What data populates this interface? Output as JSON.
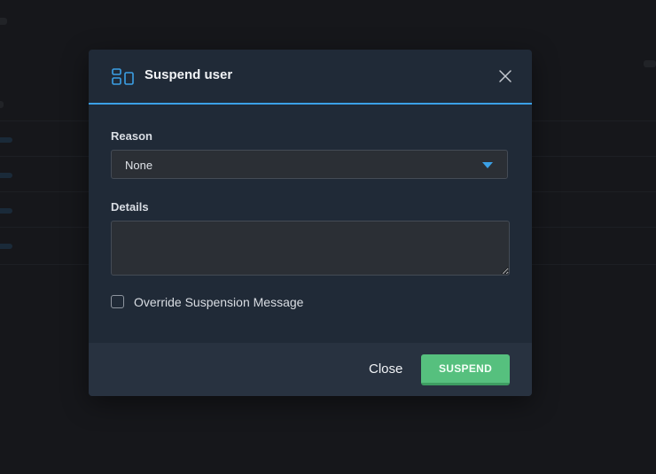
{
  "modal": {
    "title": "Suspend user",
    "header_icon": "layout-panels-icon",
    "close_icon": "close-icon"
  },
  "form": {
    "reason_label": "Reason",
    "reason_value": "None",
    "details_label": "Details",
    "details_value": "",
    "override_label": "Override Suspension Message",
    "override_checked": false
  },
  "footer": {
    "close_label": "Close",
    "suspend_label": "SUSPEND"
  },
  "colors": {
    "accent": "#3ba0e6",
    "suspend_button": "#56c07e",
    "modal_background": "#202a37",
    "footer_background": "#283240"
  }
}
